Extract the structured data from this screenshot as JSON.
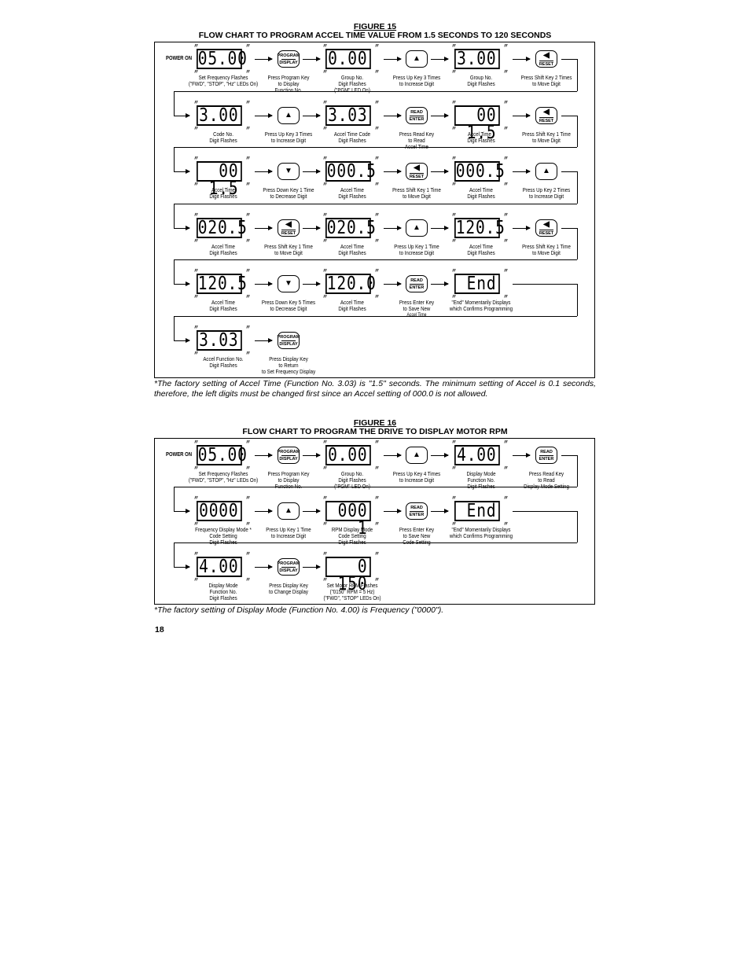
{
  "figure15": {
    "number": "FIGURE 15",
    "title": "FLOW CHART TO PROGRAM ACCEL TIME VALUE FROM 1.5 SECONDS TO 120 SECONDS",
    "power_on": "POWER ON",
    "rows": [
      [
        {
          "type": "display",
          "value": "05.00",
          "label": [
            "Set Frequency Flashes",
            "(\"FWD\", \"STOP\", \"Hz\" LEDs On)"
          ]
        },
        {
          "type": "key",
          "key": "program-display",
          "label": [
            "Press Program Key",
            "to Display",
            "Function No."
          ]
        },
        {
          "type": "display",
          "value": "0.00",
          "label": [
            "Group No.",
            "Digit Flashes",
            "(\"PGM\" LED On)"
          ]
        },
        {
          "type": "key",
          "key": "up",
          "label": [
            "Press Up Key 3 Times",
            "to Increase Digit"
          ]
        },
        {
          "type": "display",
          "value": "3.00",
          "label": [
            "Group No.",
            "Digit Flashes"
          ]
        },
        {
          "type": "key",
          "key": "shift-reset",
          "label": [
            "Press Shift Key 2 Times",
            "to Move Digit"
          ]
        }
      ],
      [
        {
          "type": "display",
          "value": "3.00",
          "label": [
            "Code No.",
            "Digit Flashes"
          ]
        },
        {
          "type": "key",
          "key": "up",
          "label": [
            "Press Up Key 3 Times",
            "to Increase Digit"
          ]
        },
        {
          "type": "display",
          "value": "3.03",
          "label": [
            "Accel Time Code",
            "Digit Flashes"
          ]
        },
        {
          "type": "key",
          "key": "read-enter",
          "label": [
            "Press Read Key",
            "to Read",
            "Accel Time"
          ]
        },
        {
          "type": "display",
          "value": "00 1.5",
          "label": [
            "Accel Time *",
            "Digit Flashes"
          ]
        },
        {
          "type": "key",
          "key": "shift-reset",
          "label": [
            "Press Shift Key 1 Time",
            "to Move Digit"
          ]
        }
      ],
      [
        {
          "type": "display",
          "value": "00 1.5",
          "label": [
            "Accel Time",
            "Digit Flashes"
          ]
        },
        {
          "type": "key",
          "key": "down",
          "label": [
            "Press Down Key 1 Time",
            "to Decrease Digit"
          ]
        },
        {
          "type": "display",
          "value": "000.5",
          "label": [
            "Accel Time",
            "Digit Flashes"
          ]
        },
        {
          "type": "key",
          "key": "shift-reset",
          "label": [
            "Press Shift Key 1 Time",
            "to Move Digit"
          ]
        },
        {
          "type": "display",
          "value": "000.5",
          "label": [
            "Accel Time",
            "Digit Flashes"
          ]
        },
        {
          "type": "key",
          "key": "up",
          "label": [
            "Press Up Key 2 Times",
            "to Increase Digit"
          ]
        }
      ],
      [
        {
          "type": "display",
          "value": "020.5",
          "label": [
            "Accel Time",
            "Digit Flashes"
          ]
        },
        {
          "type": "key",
          "key": "shift-reset",
          "label": [
            "Press Shift Key 1 Time",
            "to Move Digit"
          ]
        },
        {
          "type": "display",
          "value": "020.5",
          "label": [
            "Accel Time",
            "Digit Flashes"
          ]
        },
        {
          "type": "key",
          "key": "up",
          "label": [
            "Press Up Key 1 Time",
            "to Increase Digit"
          ]
        },
        {
          "type": "display",
          "value": "120.5",
          "label": [
            "Accel Time",
            "Digit Flashes"
          ]
        },
        {
          "type": "key",
          "key": "shift-reset",
          "label": [
            "Press Shift Key 1 Time",
            "to Move Digit"
          ]
        }
      ],
      [
        {
          "type": "display",
          "value": "120.5",
          "label": [
            "Accel Time",
            "Digit Flashes"
          ]
        },
        {
          "type": "key",
          "key": "down",
          "label": [
            "Press Down Key 5 Times",
            "to Decrease Digit"
          ]
        },
        {
          "type": "display",
          "value": "120.0",
          "label": [
            "Accel Time",
            "Digit Flashes"
          ]
        },
        {
          "type": "key",
          "key": "read-enter",
          "label": [
            "Press Enter Key",
            "to Save New"
          ],
          "small": "Accel Time"
        },
        {
          "type": "display",
          "value": "End",
          "label": [
            "\"End\" Momentarily Displays",
            "which Confirms Programming"
          ]
        }
      ],
      [
        {
          "type": "display",
          "value": "3.03",
          "label": [
            "Accel Function No.",
            "Digit Flashes"
          ]
        },
        {
          "type": "key",
          "key": "program-display",
          "label": [
            "Press Display Key",
            "to Return",
            "to Set Frequency Display"
          ]
        }
      ]
    ],
    "footnote": "*The factory setting of Accel Time (Function No. 3.03) is \"1.5\" seconds.  The minimum setting of Accel is 0.1 seconds, therefore, the left digits must be changed first since an Accel setting of 000.0 is not allowed."
  },
  "figure16": {
    "number": "FIGURE 16",
    "title": "FLOW CHART TO PROGRAM THE DRIVE TO DISPLAY MOTOR RPM",
    "power_on": "POWER ON",
    "rows": [
      [
        {
          "type": "display",
          "value": "05.00",
          "label": [
            "Set Frequency Flashes",
            "(\"FWD\", \"STOP\", \"Hz\" LEDs On)"
          ]
        },
        {
          "type": "key",
          "key": "program-display",
          "label": [
            "Press Program Key",
            "to Display",
            "Function No."
          ]
        },
        {
          "type": "display",
          "value": "0.00",
          "label": [
            "Group No.",
            "Digit Flashes",
            "(\"PGM\" LED On)"
          ]
        },
        {
          "type": "key",
          "key": "up",
          "label": [
            "Press Up Key 4 Times",
            "to Increase Digit"
          ]
        },
        {
          "type": "display",
          "value": "4.00",
          "label": [
            "Display Mode",
            "Function No.",
            "Digit Flashes"
          ]
        },
        {
          "type": "key",
          "key": "read-enter",
          "label": [
            "Press Read Key",
            "to Read",
            "Display Mode Setting"
          ]
        }
      ],
      [
        {
          "type": "display",
          "value": "0000",
          "label": [
            "Frequency Display Mode *",
            "Code Setting",
            "Digit Flashes"
          ]
        },
        {
          "type": "key",
          "key": "up",
          "label": [
            "Press Up Key 1 Time",
            "to Increase Digit"
          ]
        },
        {
          "type": "display",
          "value": "000 1",
          "label": [
            "RPM Display Mode",
            "Code Setting",
            "Digit Flashes"
          ]
        },
        {
          "type": "key",
          "key": "read-enter",
          "label": [
            "Press Enter Key",
            "to Save New",
            "Code Setting"
          ]
        },
        {
          "type": "display",
          "value": "End",
          "label": [
            "\"End\" Momentarily Displays",
            "which Confirms Programming"
          ]
        }
      ],
      [
        {
          "type": "display",
          "value": "4.00",
          "label": [
            "Display Mode",
            "Function No.",
            "Digit Flashes"
          ]
        },
        {
          "type": "key",
          "key": "program-display",
          "label": [
            "Press Display Key",
            "to Change Display"
          ]
        },
        {
          "type": "display",
          "value": "0 150",
          "label": [
            "Set Motor RPM Flashes",
            "(\"0150\" RPM = 5 Hz)",
            "(\"FWD\", \"STOP\" LEDs On)"
          ]
        }
      ]
    ],
    "footnote": "*The factory setting of Display Mode (Function No. 4.00) is Frequency (\"0000\")."
  },
  "keys": {
    "program-display": {
      "top": "PROGRAM",
      "bottom": "DISPLAY",
      "icon": "program-display-key-icon"
    },
    "read-enter": {
      "top": "READ",
      "bottom": "ENTER",
      "icon": "read-enter-key-icon"
    },
    "shift-reset": {
      "top": "◀",
      "bottom": "RESET",
      "icon": "shift-reset-key-icon"
    },
    "up": {
      "glyph": "▲",
      "icon": "up-key-icon"
    },
    "down": {
      "glyph": "▼",
      "icon": "down-key-icon"
    }
  },
  "page_number": "18"
}
